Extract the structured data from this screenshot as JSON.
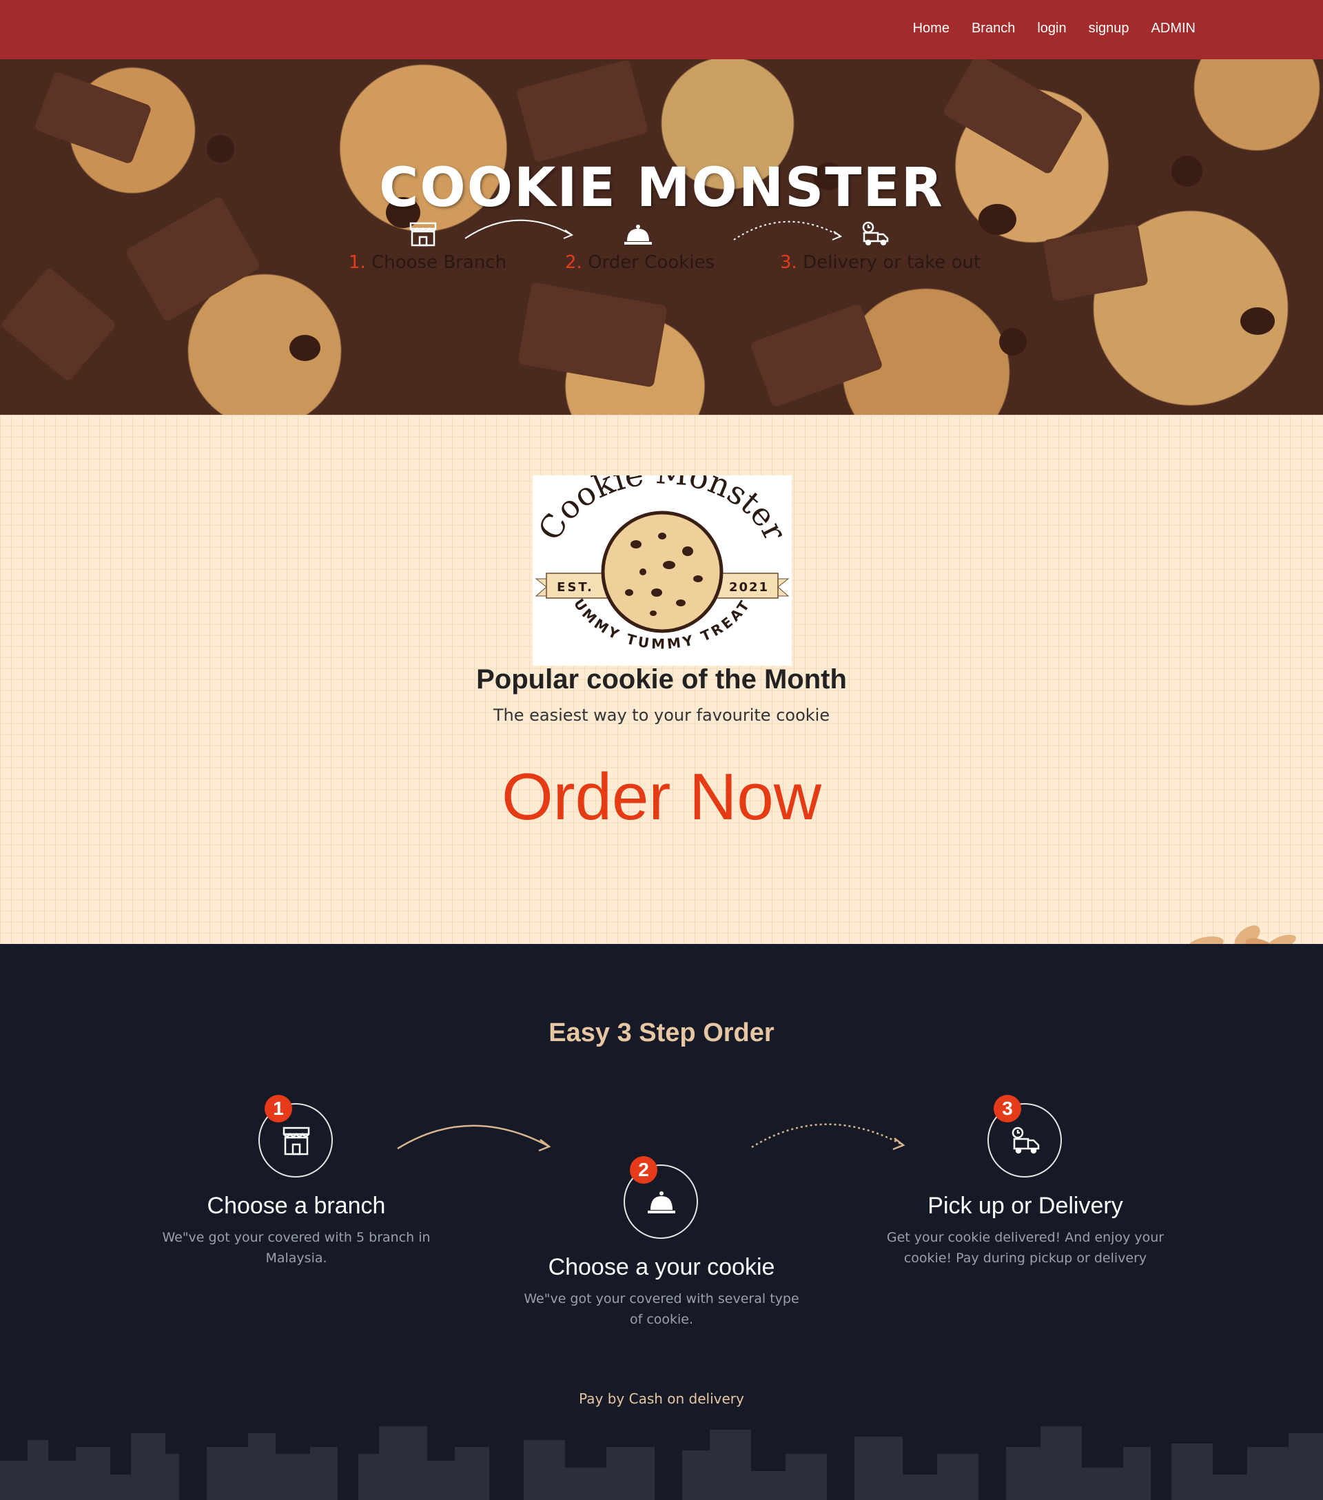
{
  "nav": {
    "items": [
      {
        "label": "Home"
      },
      {
        "label": "Branch"
      },
      {
        "label": "login"
      },
      {
        "label": "signup"
      },
      {
        "label": "ADMIN"
      }
    ]
  },
  "hero": {
    "title": "COOKIE MONSTER",
    "steps": [
      {
        "num": "1.",
        "label": "Choose Branch",
        "icon": "store-icon"
      },
      {
        "num": "2.",
        "label": "Order Cookies",
        "icon": "cloche-icon"
      },
      {
        "num": "3.",
        "label": "Delivery or take out",
        "icon": "delivery-truck-icon"
      }
    ]
  },
  "promo": {
    "logo": {
      "top": "Cookie Monster",
      "est": "EST.",
      "year": "2021",
      "bottom": "YUMMY TUMMY TREATS"
    },
    "title": "Popular cookie of the Month",
    "subtitle": "The easiest way to your favourite cookie",
    "cta": "Order Now"
  },
  "steps": {
    "title": "Easy 3 Step Order",
    "items": [
      {
        "badge": "1",
        "title": "Choose a branch",
        "desc": "We\"ve got your covered with 5 branch in Malaysia."
      },
      {
        "badge": "2",
        "title": "Choose a your cookie",
        "desc": "We\"ve got your covered with several type of cookie."
      },
      {
        "badge": "3",
        "title": "Pick up or Delivery",
        "desc": "Get your cookie delivered! And enjoy your cookie! Pay during pickup or delivery"
      }
    ],
    "pay_note": "Pay by Cash on delivery"
  },
  "colors": {
    "nav": "#a42b2c",
    "accent": "#e63b1a",
    "cta": "#e43b14",
    "dark": "#151a26",
    "gold": "#e7c6a3"
  }
}
